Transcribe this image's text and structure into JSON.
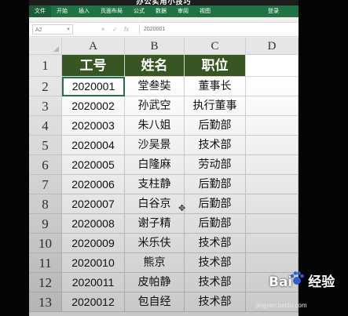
{
  "banner": {
    "title": "办公实用小技巧"
  },
  "ribbon": {
    "tabs": [
      "文件",
      "开始",
      "插入",
      "页面布局",
      "公式",
      "数据",
      "审阅",
      "视图"
    ],
    "login": "登录"
  },
  "formula_bar": {
    "cell_ref": "A2",
    "cancel_icon": "×",
    "enter_icon": "✓",
    "fx_label": "fx",
    "value": "2020001"
  },
  "sheet": {
    "columns": [
      "A",
      "B",
      "C",
      "D"
    ],
    "rows": [
      "1",
      "2",
      "3",
      "4",
      "5",
      "6",
      "7",
      "8",
      "9",
      "10",
      "11",
      "12",
      "13"
    ],
    "header": [
      "工号",
      "姓名",
      "职位"
    ],
    "data": [
      [
        "2020001",
        "堂叁奘",
        "董事长"
      ],
      [
        "2020002",
        "孙武空",
        "执行董事"
      ],
      [
        "2020003",
        "朱八姐",
        "后勤部"
      ],
      [
        "2020004",
        "沙吴景",
        "技术部"
      ],
      [
        "2020005",
        "白隆麻",
        "劳动部"
      ],
      [
        "2020006",
        "支柱静",
        "后勤部"
      ],
      [
        "2020007",
        "白谷京",
        "后勤部"
      ],
      [
        "2020008",
        "谢子精",
        "后勤部"
      ],
      [
        "2020009",
        "米乐伕",
        "技术部"
      ],
      [
        "2020010",
        "熊京",
        "技术部"
      ],
      [
        "2020011",
        "皮帕静",
        "技术部"
      ],
      [
        "2020012",
        "包自经",
        "技术部"
      ]
    ],
    "header_color": "#375623"
  },
  "watermark": {
    "brand_left": "Bai",
    "brand_right": "经验",
    "url": "jingyan.baidu.com"
  },
  "theme": {
    "ribbon": "#217346"
  }
}
